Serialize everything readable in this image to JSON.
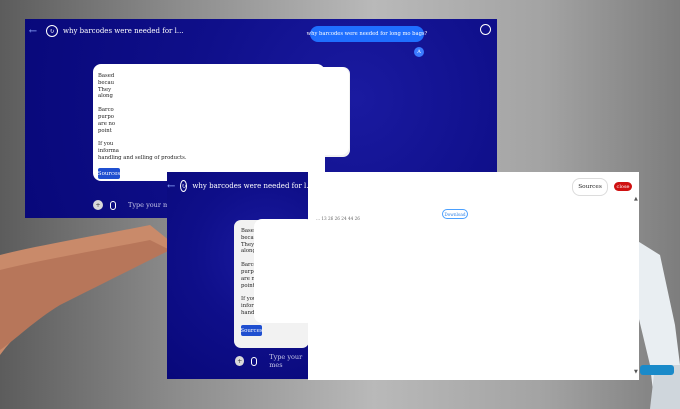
{
  "window1": {
    "nav_back": "←",
    "title": "why barcodes were needed for l...",
    "user_message": "why barcodes were needed for long mo bags?",
    "user_avatar": "A",
    "answer_lines": [
      [
        "Based",
        "becau",
        "They",
        "along"
      ],
      [
        "Barco",
        "purpo",
        "are no",
        "point"
      ],
      [
        "If you",
        "informa",
        "handling and selling of products."
      ]
    ],
    "sources_label": "Sources",
    "input_placeholder": "Type your mes"
  },
  "window2": {
    "nav_back": "←",
    "title": "why barcodes were needed for l...",
    "answer_lines": [
      [
        "Base",
        "becau",
        "They",
        "along"
      ],
      [
        "Barco",
        "purpo",
        "are no",
        "point"
      ],
      [
        "If you",
        "infor",
        "handl"
      ]
    ],
    "sources_label": "Sources",
    "input_placeholder": "Type your mes"
  },
  "window3": {
    "sources_label": "Sources",
    "close_label": "close",
    "download_label": "Download",
    "timestamp": "... 13 26 26 24 44 26"
  },
  "icons": {
    "back": "arrow-left-icon",
    "refresh": "refresh-icon",
    "profile": "user-circle-icon",
    "plus": "plus-icon",
    "mic": "microphone-icon"
  },
  "colors": {
    "window_bg": "#0f0f8a",
    "user_bubble": "#1f6fff",
    "sources_button": "#1f4fd0",
    "close_button": "#cf1010"
  }
}
